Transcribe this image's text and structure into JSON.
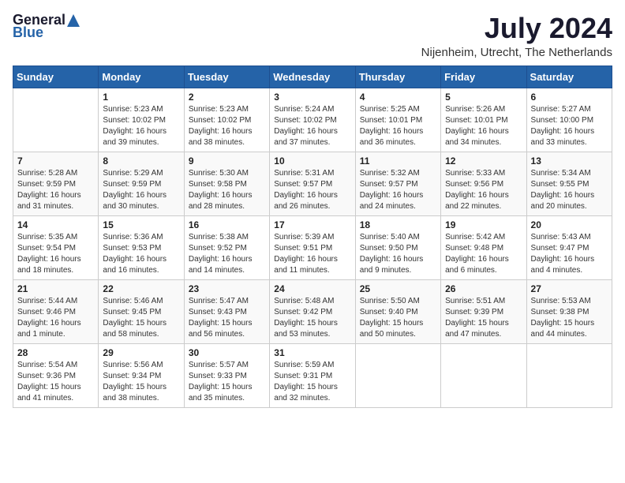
{
  "header": {
    "logo_line1": "General",
    "logo_line2": "Blue",
    "month_year": "July 2024",
    "location": "Nijenheim, Utrecht, The Netherlands"
  },
  "calendar": {
    "days_of_week": [
      "Sunday",
      "Monday",
      "Tuesday",
      "Wednesday",
      "Thursday",
      "Friday",
      "Saturday"
    ],
    "weeks": [
      [
        {
          "day": "",
          "info": ""
        },
        {
          "day": "1",
          "info": "Sunrise: 5:23 AM\nSunset: 10:02 PM\nDaylight: 16 hours\nand 39 minutes."
        },
        {
          "day": "2",
          "info": "Sunrise: 5:23 AM\nSunset: 10:02 PM\nDaylight: 16 hours\nand 38 minutes."
        },
        {
          "day": "3",
          "info": "Sunrise: 5:24 AM\nSunset: 10:02 PM\nDaylight: 16 hours\nand 37 minutes."
        },
        {
          "day": "4",
          "info": "Sunrise: 5:25 AM\nSunset: 10:01 PM\nDaylight: 16 hours\nand 36 minutes."
        },
        {
          "day": "5",
          "info": "Sunrise: 5:26 AM\nSunset: 10:01 PM\nDaylight: 16 hours\nand 34 minutes."
        },
        {
          "day": "6",
          "info": "Sunrise: 5:27 AM\nSunset: 10:00 PM\nDaylight: 16 hours\nand 33 minutes."
        }
      ],
      [
        {
          "day": "7",
          "info": "Sunrise: 5:28 AM\nSunset: 9:59 PM\nDaylight: 16 hours\nand 31 minutes."
        },
        {
          "day": "8",
          "info": "Sunrise: 5:29 AM\nSunset: 9:59 PM\nDaylight: 16 hours\nand 30 minutes."
        },
        {
          "day": "9",
          "info": "Sunrise: 5:30 AM\nSunset: 9:58 PM\nDaylight: 16 hours\nand 28 minutes."
        },
        {
          "day": "10",
          "info": "Sunrise: 5:31 AM\nSunset: 9:57 PM\nDaylight: 16 hours\nand 26 minutes."
        },
        {
          "day": "11",
          "info": "Sunrise: 5:32 AM\nSunset: 9:57 PM\nDaylight: 16 hours\nand 24 minutes."
        },
        {
          "day": "12",
          "info": "Sunrise: 5:33 AM\nSunset: 9:56 PM\nDaylight: 16 hours\nand 22 minutes."
        },
        {
          "day": "13",
          "info": "Sunrise: 5:34 AM\nSunset: 9:55 PM\nDaylight: 16 hours\nand 20 minutes."
        }
      ],
      [
        {
          "day": "14",
          "info": "Sunrise: 5:35 AM\nSunset: 9:54 PM\nDaylight: 16 hours\nand 18 minutes."
        },
        {
          "day": "15",
          "info": "Sunrise: 5:36 AM\nSunset: 9:53 PM\nDaylight: 16 hours\nand 16 minutes."
        },
        {
          "day": "16",
          "info": "Sunrise: 5:38 AM\nSunset: 9:52 PM\nDaylight: 16 hours\nand 14 minutes."
        },
        {
          "day": "17",
          "info": "Sunrise: 5:39 AM\nSunset: 9:51 PM\nDaylight: 16 hours\nand 11 minutes."
        },
        {
          "day": "18",
          "info": "Sunrise: 5:40 AM\nSunset: 9:50 PM\nDaylight: 16 hours\nand 9 minutes."
        },
        {
          "day": "19",
          "info": "Sunrise: 5:42 AM\nSunset: 9:48 PM\nDaylight: 16 hours\nand 6 minutes."
        },
        {
          "day": "20",
          "info": "Sunrise: 5:43 AM\nSunset: 9:47 PM\nDaylight: 16 hours\nand 4 minutes."
        }
      ],
      [
        {
          "day": "21",
          "info": "Sunrise: 5:44 AM\nSunset: 9:46 PM\nDaylight: 16 hours\nand 1 minute."
        },
        {
          "day": "22",
          "info": "Sunrise: 5:46 AM\nSunset: 9:45 PM\nDaylight: 15 hours\nand 58 minutes."
        },
        {
          "day": "23",
          "info": "Sunrise: 5:47 AM\nSunset: 9:43 PM\nDaylight: 15 hours\nand 56 minutes."
        },
        {
          "day": "24",
          "info": "Sunrise: 5:48 AM\nSunset: 9:42 PM\nDaylight: 15 hours\nand 53 minutes."
        },
        {
          "day": "25",
          "info": "Sunrise: 5:50 AM\nSunset: 9:40 PM\nDaylight: 15 hours\nand 50 minutes."
        },
        {
          "day": "26",
          "info": "Sunrise: 5:51 AM\nSunset: 9:39 PM\nDaylight: 15 hours\nand 47 minutes."
        },
        {
          "day": "27",
          "info": "Sunrise: 5:53 AM\nSunset: 9:38 PM\nDaylight: 15 hours\nand 44 minutes."
        }
      ],
      [
        {
          "day": "28",
          "info": "Sunrise: 5:54 AM\nSunset: 9:36 PM\nDaylight: 15 hours\nand 41 minutes."
        },
        {
          "day": "29",
          "info": "Sunrise: 5:56 AM\nSunset: 9:34 PM\nDaylight: 15 hours\nand 38 minutes."
        },
        {
          "day": "30",
          "info": "Sunrise: 5:57 AM\nSunset: 9:33 PM\nDaylight: 15 hours\nand 35 minutes."
        },
        {
          "day": "31",
          "info": "Sunrise: 5:59 AM\nSunset: 9:31 PM\nDaylight: 15 hours\nand 32 minutes."
        },
        {
          "day": "",
          "info": ""
        },
        {
          "day": "",
          "info": ""
        },
        {
          "day": "",
          "info": ""
        }
      ]
    ]
  }
}
